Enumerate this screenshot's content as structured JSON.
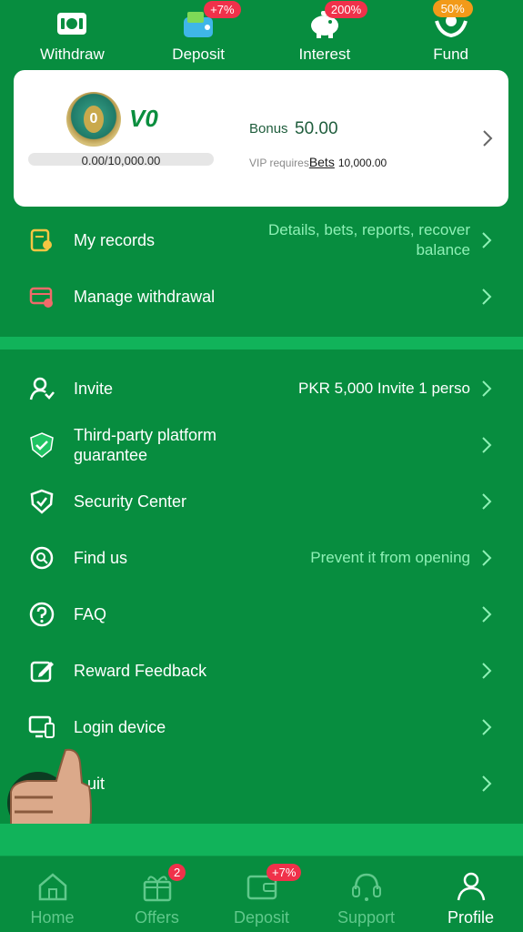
{
  "top_actions": [
    {
      "label": "Withdraw",
      "icon": "ticket-icon",
      "badge": ""
    },
    {
      "label": "Deposit",
      "icon": "wallet-icon",
      "badge": "+7%"
    },
    {
      "label": "Interest",
      "icon": "piggy-bank-icon",
      "badge": "200%"
    },
    {
      "label": "Fund",
      "icon": "hands-icon",
      "badge": "50%"
    }
  ],
  "vip": {
    "level": "V0",
    "progress_text": "0.00/10,000.00",
    "progress_fraction": 0.0,
    "bonus_label": "Bonus",
    "bonus_value": "50.00",
    "requires_label": "VIP requires",
    "bets_label": "Bets",
    "requires_amount": "10,000.00"
  },
  "menu": {
    "records": {
      "label": "My records",
      "extra_line1": "Details, bets, reports, recover",
      "extra_line2": "balance",
      "icon": "records-icon"
    },
    "withdrawal": {
      "label": "Manage withdrawal",
      "icon": "card-icon"
    },
    "invite": {
      "label": "Invite",
      "extra": "PKR 5,000  Invite 1 perso",
      "icon": "invite-user-icon"
    },
    "third_party": {
      "label_line1": "Third-party platform",
      "label_line2": "guarantee",
      "icon": "shield-check-icon"
    },
    "security": {
      "label": "Security Center",
      "icon": "security-shield-icon"
    },
    "find_us": {
      "label": "Find us",
      "extra": "Prevent it from opening",
      "icon": "find-us-icon"
    },
    "faq": {
      "label": "FAQ",
      "icon": "question-icon"
    },
    "reward_feedback": {
      "label": "Reward Feedback",
      "icon": "edit-icon"
    },
    "login_device": {
      "label": "Login device",
      "icon": "devices-icon"
    },
    "quit": {
      "label": "uit",
      "icon": "power-icon"
    }
  },
  "bottom_nav": [
    {
      "label": "Home",
      "icon": "home-icon",
      "badge": "",
      "active": false
    },
    {
      "label": "Offers",
      "icon": "gift-icon",
      "badge": "2",
      "active": false
    },
    {
      "label": "Deposit",
      "icon": "wallet-icon",
      "badge": "+7%",
      "active": false
    },
    {
      "label": "Support",
      "icon": "headset-icon",
      "badge": "",
      "active": false
    },
    {
      "label": "Profile",
      "icon": "user-icon",
      "badge": "",
      "active": true
    }
  ],
  "colors": {
    "background": "#078d3f",
    "band": "#11b35a",
    "accent_text": "#8ef0b5",
    "badge_red": "#f0314a",
    "badge_orange": "#f29a19"
  }
}
